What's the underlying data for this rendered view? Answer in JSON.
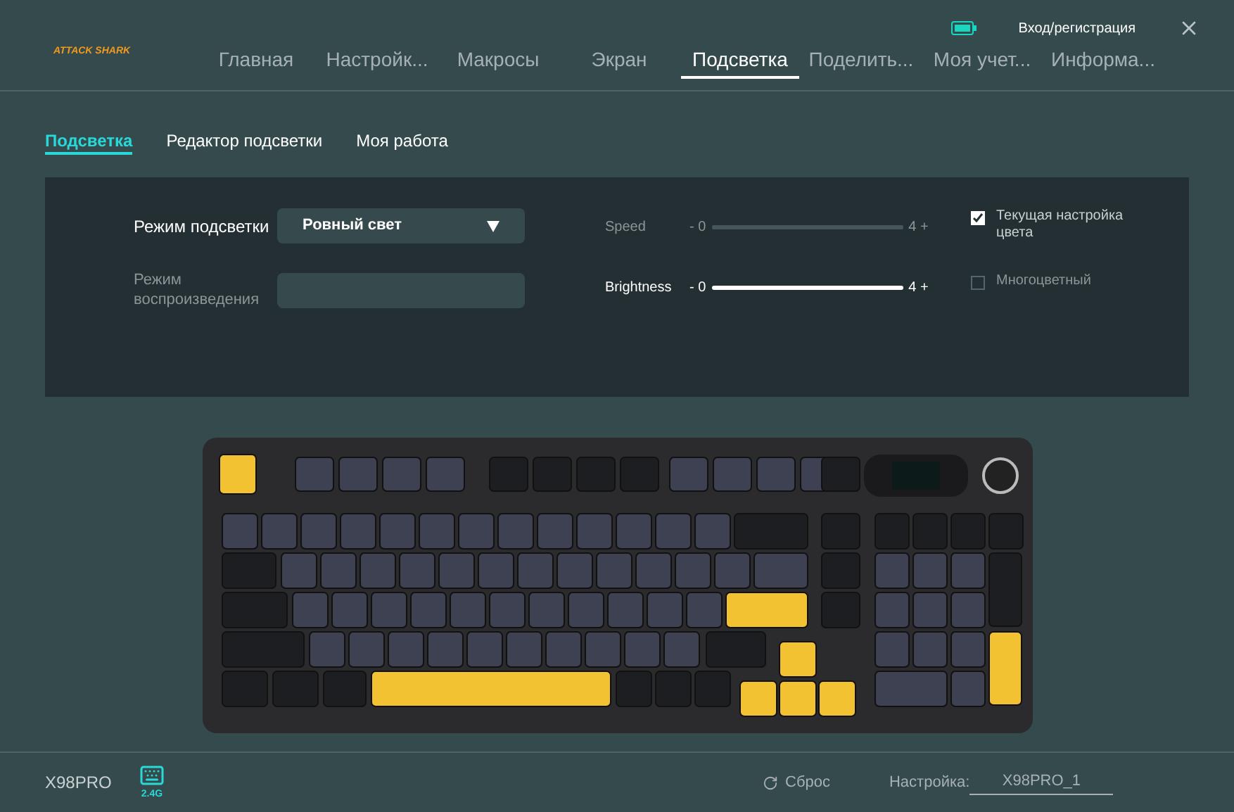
{
  "logo": {
    "text": "ATTACK SHARK"
  },
  "header": {
    "login": "Вход/регистрация"
  },
  "nav": [
    {
      "label": "Главная",
      "selected": false
    },
    {
      "label": "Настройк...",
      "selected": false
    },
    {
      "label": "Макросы",
      "selected": false
    },
    {
      "label": "Экран",
      "selected": false
    },
    {
      "label": "Подсветка",
      "selected": true
    },
    {
      "label": "Поделить...",
      "selected": false
    },
    {
      "label": "Моя учет...",
      "selected": false
    },
    {
      "label": "Информа...",
      "selected": false
    }
  ],
  "subtabs": [
    {
      "label": "Подсветка",
      "selected": true
    },
    {
      "label": "Редактор подсветки",
      "selected": false
    },
    {
      "label": "Моя работа",
      "selected": false
    }
  ],
  "mode": {
    "label": "Режим подсветки",
    "value": "Ровный свет"
  },
  "playback": {
    "label": "Режим воспроизведения",
    "disabled": true
  },
  "sliders": [
    {
      "label": "Speed",
      "min": "- 0",
      "max": "4 +",
      "level": 1,
      "disabled": true
    },
    {
      "label": "Brightness",
      "min": "- 0",
      "max": "4 +",
      "level": 1,
      "disabled": false
    }
  ],
  "options": [
    {
      "label": "Текущая настройка цвета",
      "checked": true
    },
    {
      "label": "Многоцветный",
      "checked": false
    }
  ],
  "footer": {
    "device": "X98PRO",
    "connection": "2.4G",
    "reset": "Сброс",
    "profile_label": "Настройка:",
    "profile": "X98PRO_1"
  }
}
